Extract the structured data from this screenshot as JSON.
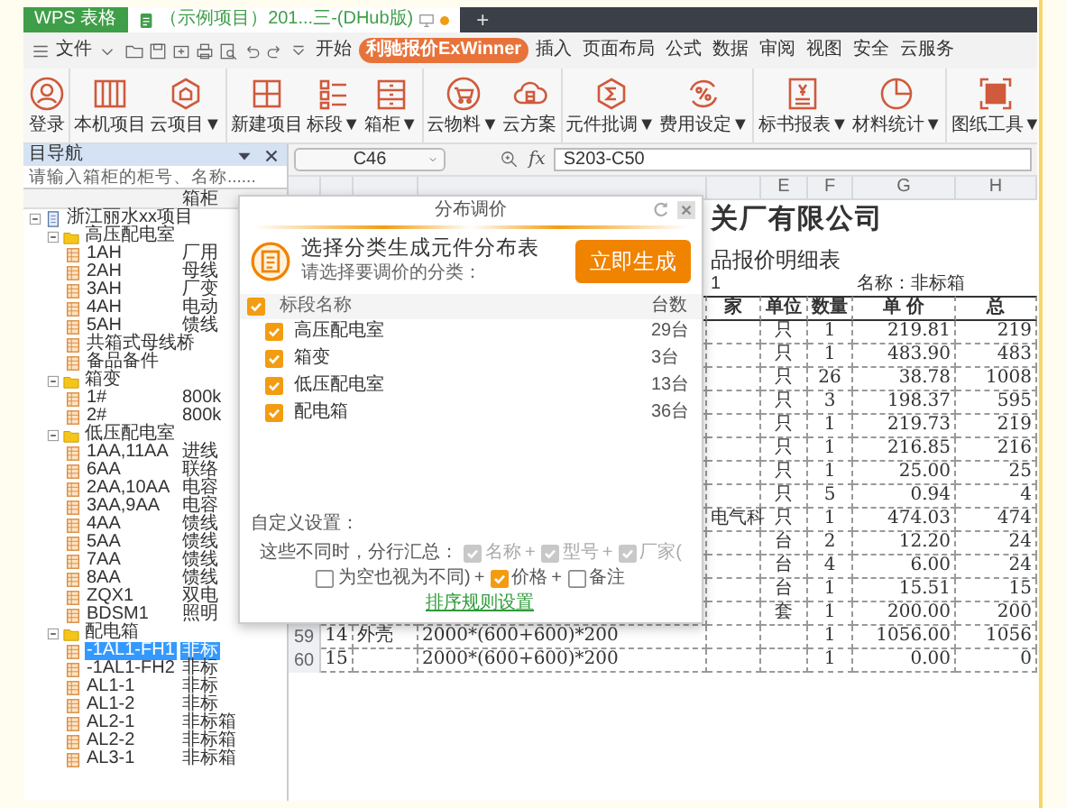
{
  "tabs": [
    {
      "label": "WPS 表格",
      "kind": "app"
    },
    {
      "label": "（示例项目）201...三-(DHub版)",
      "kind": "doc",
      "selected": true
    },
    {
      "label": "+",
      "kind": "add"
    }
  ],
  "menu": {
    "file": "文件",
    "tabs": [
      {
        "label": "开始",
        "selected": false
      },
      {
        "label": "利驰报价ExWinner",
        "selected": true
      },
      {
        "label": "插入",
        "selected": false
      },
      {
        "label": "页面布局",
        "selected": false
      },
      {
        "label": "公式",
        "selected": false
      },
      {
        "label": "数据",
        "selected": false
      },
      {
        "label": "审阅",
        "selected": false
      },
      {
        "label": "视图",
        "selected": false
      },
      {
        "label": "安全",
        "selected": false
      },
      {
        "label": "云服务",
        "selected": false
      }
    ]
  },
  "ribbon": [
    {
      "label": "登录",
      "separator_before": false
    },
    {
      "label": "本机项目",
      "separator_before": true
    },
    {
      "label": "云项目▼",
      "separator_before": false
    },
    {
      "label": "新建项目",
      "separator_before": true
    },
    {
      "label": "标段▼",
      "separator_before": false
    },
    {
      "label": "箱柜▼",
      "separator_before": false
    },
    {
      "label": "云物料▼",
      "separator_before": true
    },
    {
      "label": "云方案",
      "separator_before": false
    },
    {
      "label": "元件批调▼",
      "separator_before": true
    },
    {
      "label": "费用设定▼",
      "separator_before": false
    },
    {
      "label": "标书报表▼",
      "separator_before": true
    },
    {
      "label": "材料统计▼",
      "separator_before": false
    },
    {
      "label": "图纸工具▼",
      "separator_before": true
    }
  ],
  "navigator": {
    "title": "目导航",
    "search_placeholder": "请输入箱柜的柜号、名称......",
    "column_2": "箱柜",
    "tree": [
      {
        "label": "浙江丽水xx项目",
        "kind": "project",
        "expanded": true,
        "selected": false,
        "children": [
          {
            "label": "高压配电室",
            "kind": "folder",
            "expanded": true,
            "selected": false,
            "children": [
              {
                "label": "1AH",
                "column_2": "厂用",
                "kind": "cabinet",
                "selected": false
              },
              {
                "label": "2AH",
                "column_2": "母线",
                "kind": "cabinet",
                "selected": false
              },
              {
                "label": "3AH",
                "column_2": "厂变",
                "kind": "cabinet",
                "selected": false
              },
              {
                "label": "4AH",
                "column_2": "电动",
                "kind": "cabinet",
                "selected": false
              },
              {
                "label": "5AH",
                "column_2": "馈线",
                "kind": "cabinet",
                "selected": false
              },
              {
                "label": "共箱式母线桥",
                "kind": "cabinet",
                "selected": false
              },
              {
                "label": "备品备件",
                "kind": "cabinet",
                "selected": false
              }
            ]
          },
          {
            "label": "箱变",
            "kind": "folder",
            "expanded": true,
            "selected": false,
            "children": [
              {
                "label": "1#",
                "column_2": "800k",
                "kind": "cabinet",
                "selected": false
              },
              {
                "label": "2#",
                "column_2": "800k",
                "kind": "cabinet",
                "selected": false
              }
            ]
          },
          {
            "label": "低压配电室",
            "kind": "folder",
            "expanded": true,
            "selected": false,
            "children": [
              {
                "label": "1AA,11AA",
                "column_2": "进线",
                "kind": "cabinet",
                "selected": false
              },
              {
                "label": "6AA",
                "column_2": "联络",
                "kind": "cabinet",
                "selected": false
              },
              {
                "label": "2AA,10AA",
                "column_2": "电容",
                "kind": "cabinet",
                "selected": false
              },
              {
                "label": "3AA,9AA",
                "column_2": "电容",
                "kind": "cabinet",
                "selected": false
              },
              {
                "label": "4AA",
                "column_2": "馈线",
                "kind": "cabinet",
                "selected": false
              },
              {
                "label": "5AA",
                "column_2": "馈线",
                "kind": "cabinet",
                "selected": false
              },
              {
                "label": "7AA",
                "column_2": "馈线",
                "kind": "cabinet",
                "selected": false
              },
              {
                "label": "8AA",
                "column_2": "馈线",
                "kind": "cabinet",
                "selected": false
              },
              {
                "label": "ZQX1",
                "column_2": "双电",
                "kind": "cabinet",
                "selected": false
              },
              {
                "label": "BDSM1",
                "column_2": "照明",
                "kind": "cabinet",
                "selected": false
              }
            ]
          },
          {
            "label": "配电箱",
            "kind": "folder",
            "expanded": true,
            "selected": false,
            "children": [
              {
                "label": "-1AL1-FH1",
                "column_2": "非标",
                "kind": "cabinet",
                "selected": true
              },
              {
                "label": "-1AL1-FH2",
                "column_2": "非标",
                "kind": "cabinet",
                "selected": false
              },
              {
                "label": "AL1-1",
                "column_2": "非标",
                "kind": "cabinet",
                "selected": false
              },
              {
                "label": "AL1-2",
                "column_2": "非标",
                "kind": "cabinet",
                "selected": false
              },
              {
                "label": "AL2-1",
                "column_2": "非标箱",
                "kind": "cabinet",
                "selected": false
              },
              {
                "label": "AL2-2",
                "column_2": "非标箱",
                "kind": "cabinet",
                "selected": false
              },
              {
                "label": "AL3-1",
                "column_2": "非标箱",
                "kind": "cabinet",
                "selected": false
              }
            ]
          }
        ]
      }
    ]
  },
  "formula_bar": {
    "cell": "C46",
    "function_label": "fx",
    "formula": "S203-C50"
  },
  "sheet": {
    "column_letters": [
      "E",
      "F",
      "G",
      "H"
    ],
    "title": "关厂有限公司",
    "subtitle": "品报价明细表",
    "info": {
      "column_5": "1",
      "name": "名称：非标箱"
    },
    "header": {
      "maker": "家",
      "unit": "单位",
      "quantity": "数量",
      "unit_price": "单 价",
      "total": "总"
    },
    "rows": [
      {
        "unit": "只",
        "quantity": "1",
        "unit_price": "219.81",
        "total": "219"
      },
      {
        "unit": "只",
        "quantity": "1",
        "unit_price": "483.90",
        "total": "483"
      },
      {
        "unit": "只",
        "quantity": "26",
        "unit_price": "38.78",
        "total": "1008"
      },
      {
        "unit": "只",
        "quantity": "3",
        "unit_price": "198.37",
        "total": "595"
      },
      {
        "unit": "只",
        "quantity": "1",
        "unit_price": "219.73",
        "total": "219"
      },
      {
        "unit": "只",
        "quantity": "1",
        "unit_price": "216.85",
        "total": "216"
      },
      {
        "unit": "只",
        "quantity": "1",
        "unit_price": "25.00",
        "total": "25"
      },
      {
        "unit": "只",
        "quantity": "5",
        "unit_price": "0.94",
        "total": "4"
      },
      {
        "maker": "电气科",
        "unit": "只",
        "quantity": "1",
        "unit_price": "474.03",
        "total": "474"
      },
      {
        "unit": "台",
        "quantity": "2",
        "unit_price": "12.20",
        "total": "24"
      },
      {
        "unit": "台",
        "quantity": "4",
        "unit_price": "6.00",
        "total": "24"
      },
      {
        "unit": "台",
        "quantity": "1",
        "unit_price": "15.51",
        "total": "15"
      },
      {
        "unit": "套",
        "quantity": "1",
        "unit_price": "200.00",
        "total": "200"
      },
      {
        "row_number": "59",
        "column_2": "14",
        "column_3": "外壳",
        "column_4": "2000*(600+600)*200",
        "quantity": "1",
        "unit_price": "1056.00",
        "total": "1056"
      },
      {
        "row_number": "60",
        "column_2": "15",
        "column_4": "2000*(600+600)*200",
        "quantity": "1",
        "unit_price": "0.00",
        "total": "0"
      }
    ]
  },
  "dialog": {
    "title": "分布调价",
    "heading": "选择分类生成元件分布表",
    "subheading": "请选择要调价的分类：",
    "generate_button": "立即生成",
    "list_header": {
      "checked": true,
      "name": "标段名称",
      "count": "台数"
    },
    "items": [
      {
        "name": "高压配电室",
        "count": "29台",
        "checked": true
      },
      {
        "name": "箱变",
        "count": "3台",
        "checked": true
      },
      {
        "name": "低压配电室",
        "count": "13台",
        "checked": true
      },
      {
        "name": "配电箱",
        "count": "36台",
        "checked": true
      }
    ],
    "custom_label": "自定义设置：",
    "options_lead": "这些不同时，分行汇总：",
    "options": [
      {
        "label": "名称",
        "checked": true,
        "disabled": true,
        "after": "+"
      },
      {
        "label": "型号",
        "checked": true,
        "disabled": true,
        "after": "+"
      },
      {
        "label": "厂家(",
        "checked": true,
        "disabled": true
      },
      {
        "label": "为空也视为不同)",
        "checked": false,
        "disabled": false,
        "after": "+"
      },
      {
        "label": "价格",
        "checked": true,
        "disabled": false,
        "after": "+"
      },
      {
        "label": "备注",
        "checked": false,
        "disabled": false
      }
    ],
    "sort_link": "排序规则设置"
  }
}
